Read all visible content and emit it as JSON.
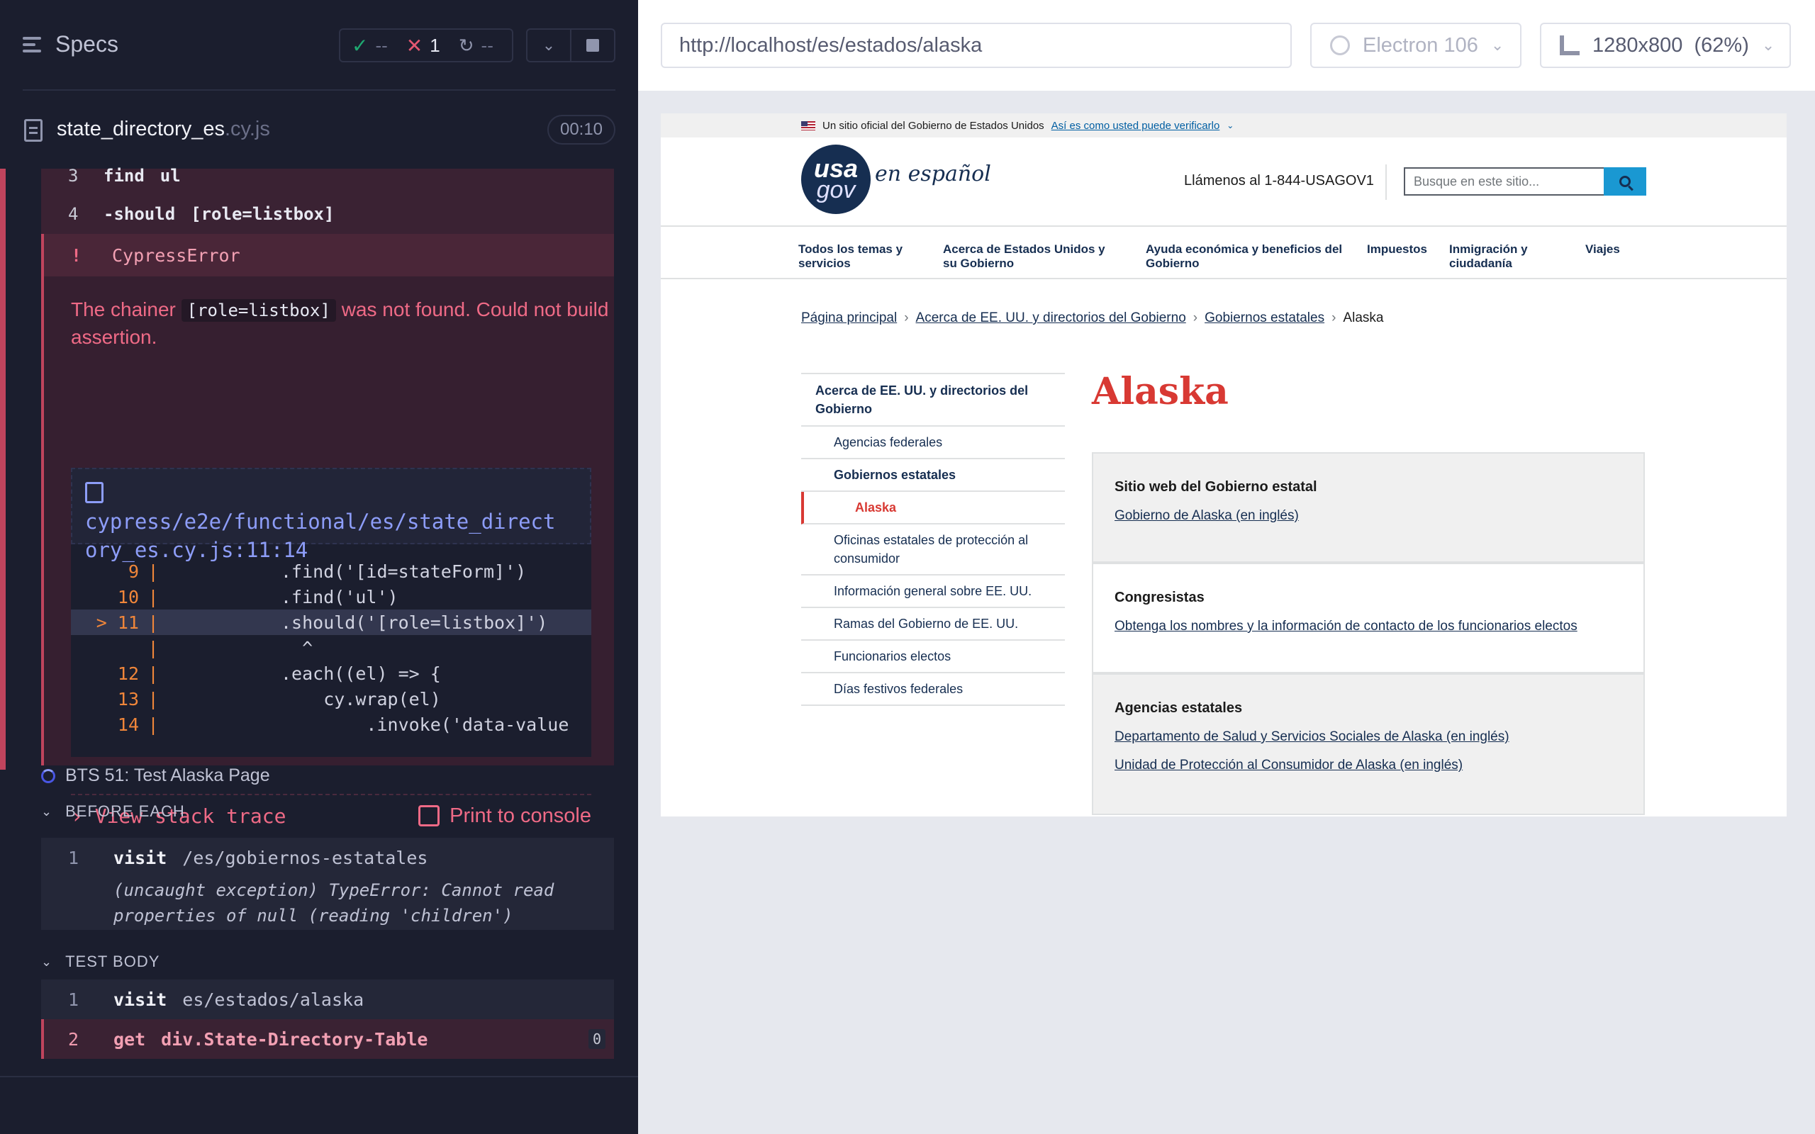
{
  "runner": {
    "specs_title": "Specs",
    "stats": {
      "passed": "--",
      "failed": "1",
      "pending": "--"
    },
    "spec_file": {
      "name": "state_directory_es",
      "ext": ".cy.js",
      "duration": "00:10"
    },
    "commands_top": [
      {
        "num": "3",
        "name": "find",
        "arg": "ul"
      },
      {
        "num": "4",
        "name": "-should",
        "arg": "[role=listbox]"
      }
    ],
    "error": {
      "label": "!",
      "type": "CypressError",
      "msg_before": "The chainer",
      "msg_code": "[role=listbox]",
      "msg_after": "was not found. Could not build assertion.",
      "file_line1": "cypress/e2e/functional/es/state_direct",
      "file_line2": "ory_es.cy.js:11:14",
      "code_lines": [
        {
          "ln": "9",
          "code": ".find('[id=stateForm]')"
        },
        {
          "ln": "10",
          "code": ".find('ul')"
        },
        {
          "ln": "> 11",
          "code": ".should('[role=listbox]')"
        },
        {
          "ln": "",
          "code": "  ^"
        },
        {
          "ln": "12",
          "code": ".each((el) => {"
        },
        {
          "ln": "13",
          "code": "    cy.wrap(el)"
        },
        {
          "ln": "14",
          "code": "        .invoke('data-value"
        }
      ],
      "view_stack": "View stack trace",
      "print_console": "Print to console"
    },
    "test2": {
      "title": "BTS 51: Test Alaska Page",
      "before_each": "BEFORE EACH",
      "be_cmd": {
        "num": "1",
        "name": "visit",
        "arg": "/es/gobiernos-estatales"
      },
      "be_error": "(uncaught exception)  TypeError: Cannot read properties of null (reading 'children')",
      "test_body": "TEST BODY",
      "tb_cmd1": {
        "num": "1",
        "name": "visit",
        "arg": "es/estados/alaska"
      },
      "tb_cmd2": {
        "num": "2",
        "name": "get",
        "arg": "div.State-Directory-Table",
        "count": "0"
      }
    }
  },
  "aut": {
    "url": "http://localhost/es/estados/alaska",
    "browser": "Electron 106",
    "viewport": "1280x800  (62%)"
  },
  "site": {
    "banner_text": "Un sitio oficial del Gobierno de Estados Unidos",
    "banner_link": "Así es como usted puede verificarlo",
    "logo_usa": "usa",
    "logo_gov": "gov",
    "logo_es": "en español",
    "call": "Llámenos al 1-844-USAGOV1",
    "search_placeholder": "Busque en este sitio...",
    "nav": [
      "Todos los temas y servicios",
      "Acerca de Estados Unidos y su Gobierno",
      "Ayuda económica y beneficios del Gobierno",
      "Impuestos",
      "Inmigración y ciudadanía",
      "Viajes"
    ],
    "breadcrumbs": [
      "Página principal",
      "Acerca de EE. UU. y directorios del Gobierno",
      "Gobiernos estatales",
      "Alaska"
    ],
    "sidenav": {
      "top": "Acerca de EE. UU. y directorios del Gobierno",
      "items": [
        "Agencias federales",
        "Gobiernos estatales",
        "Alaska",
        "Oficinas estatales de protección al consumidor",
        "Información general sobre EE. UU.",
        "Ramas del Gobierno de EE. UU.",
        "Funcionarios electos",
        "Días festivos federales"
      ]
    },
    "heading": "Alaska",
    "cards": [
      {
        "title": "Sitio web del Gobierno estatal",
        "links": [
          "Gobierno de Alaska (en inglés)"
        ]
      },
      {
        "title": "Congresistas",
        "links": [
          "Obtenga los nombres y la información de contacto de los funcionarios electos"
        ]
      },
      {
        "title": "Agencias estatales",
        "links": [
          "Departamento de Salud y Servicios Sociales de Alaska (en inglés)",
          "Unidad de Protección al Consumidor de Alaska (en inglés)"
        ]
      }
    ]
  }
}
